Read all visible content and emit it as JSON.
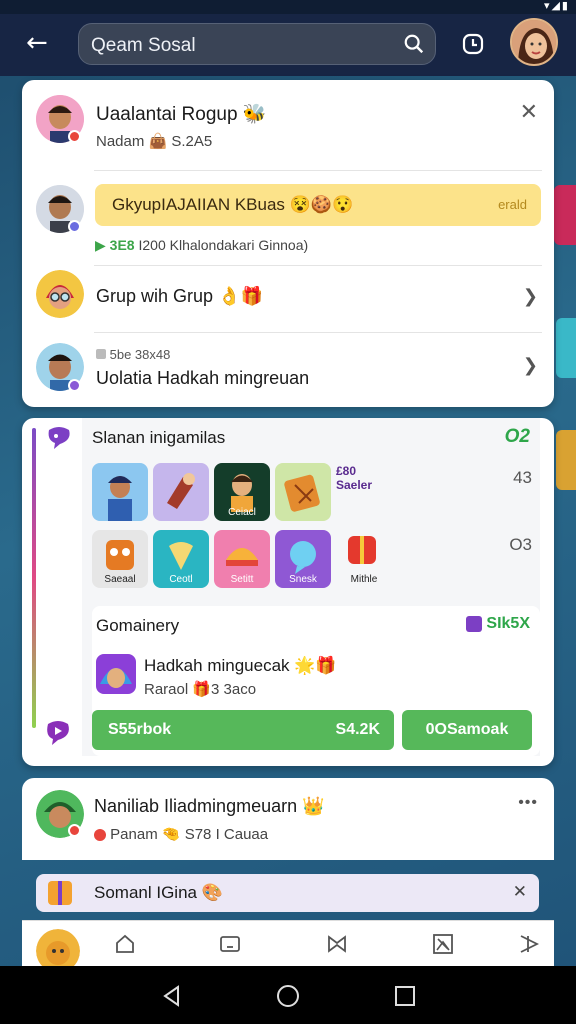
{
  "header": {
    "search_text": "Qeam Sosal",
    "icons": [
      "back-arrow-icon",
      "search-icon",
      "history-icon",
      "profile-avatar"
    ]
  },
  "card1": {
    "item1": {
      "title": "Uaalantai Rogup 🐝",
      "meta": "Nadam 👜 S.2A5"
    },
    "item2": {
      "banner": "GkyupIAJAIIAN KBuas 😵🍪😯",
      "banner_side": "erald",
      "meta_count": "3E8",
      "meta_text": "I200 Klhalondakari Ginnoa)"
    },
    "item3": {
      "title": "Grup wih Grup 👌🎁"
    },
    "item4": {
      "meta": "5be 38x48",
      "title": "Uolatia Hadkah mingreuan"
    }
  },
  "card2": {
    "header": "Slanan inigamilas",
    "header_badge": "O2",
    "row1_side_text": "£80 Saeler",
    "row1_count": "43",
    "row2_count": "O3",
    "tiles_row1": [
      "",
      "",
      "Ceiacl",
      ""
    ],
    "tiles_row2": [
      "Saeaal",
      "Ceotl",
      "Setitt",
      "Snesk",
      "Mithle"
    ],
    "sub": {
      "title": "Gomainery",
      "badge": "SIk5X",
      "item_title": "Hadkah minguecak 🌟🎁",
      "item_meta": "Raraol 🎁3 3aco"
    },
    "buttons": [
      "S55rbok",
      "S4.2K",
      "0OSamoak"
    ]
  },
  "card3": {
    "title": "Naniliab Iliadmingmeuarn 👑",
    "meta": "Panam 🤏 S78 I Cauaa",
    "more": "•••"
  },
  "toast": {
    "text": "Somanl IGina 🎨",
    "close": "✕"
  },
  "colors": {
    "accent": "#56b85a",
    "topbar": "#172544",
    "banner": "#fce38a"
  }
}
